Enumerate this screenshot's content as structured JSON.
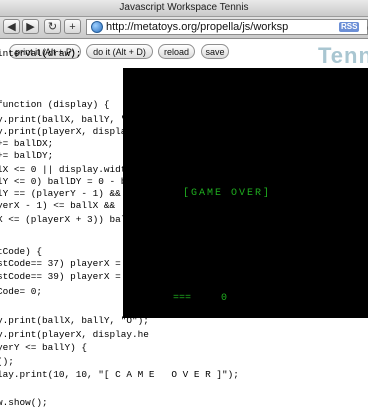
{
  "window": {
    "title": "Javascript Workspace Tennis"
  },
  "toolbar": {
    "back_glyph": "◀",
    "forward_glyph": "▶",
    "reload_glyph": "↻",
    "add_glyph": "+",
    "url": "http://metatoys.org/propella/js/worksp",
    "rss_label": "RSS",
    "subscribe_glyph": "Q"
  },
  "controls": {
    "print_label": "print it (Alt + P)",
    "doit_label": "do it (Alt + D)",
    "reload_label": "reload",
    "save_label": "save"
  },
  "brand": "Tenni",
  "code_lines": [
    "interval(draw);",
    "",
    "function (display) {",
    "y.print(ballX, ballY, \" \");",
    "y.print(playerX, display.he",
    "+= ballDX;",
    "+= ballDY;",
    "lX <= 0 || display.width <",
    "lY <= 0) ballDY = 0 - ball",
    "lY == (playerY - 1) &&",
    "yerX - 1) <= ballX &&",
    "X <= (playerX + 3)) ballDY",
    "",
    "tCode) {",
    "stCode== 37) playerX = (",
    "stCode== 39) playerX = (",
    "Code= 0;",
    "",
    "y.print(ballX, ballY, \"O\");",
    "y.print(playerX, display.he",
    "yerY <= ballY) {",
    "();",
    "lay.print(10, 10, \"[ C A M E   O V E R ]\");",
    "",
    "w.show();"
  ],
  "game": {
    "message": "[GAME OVER]",
    "paddle": "===",
    "score": "0"
  },
  "colors": {
    "game_bg": "#000000",
    "game_text": "#1fae1f",
    "brand": "#a9c6d1"
  }
}
